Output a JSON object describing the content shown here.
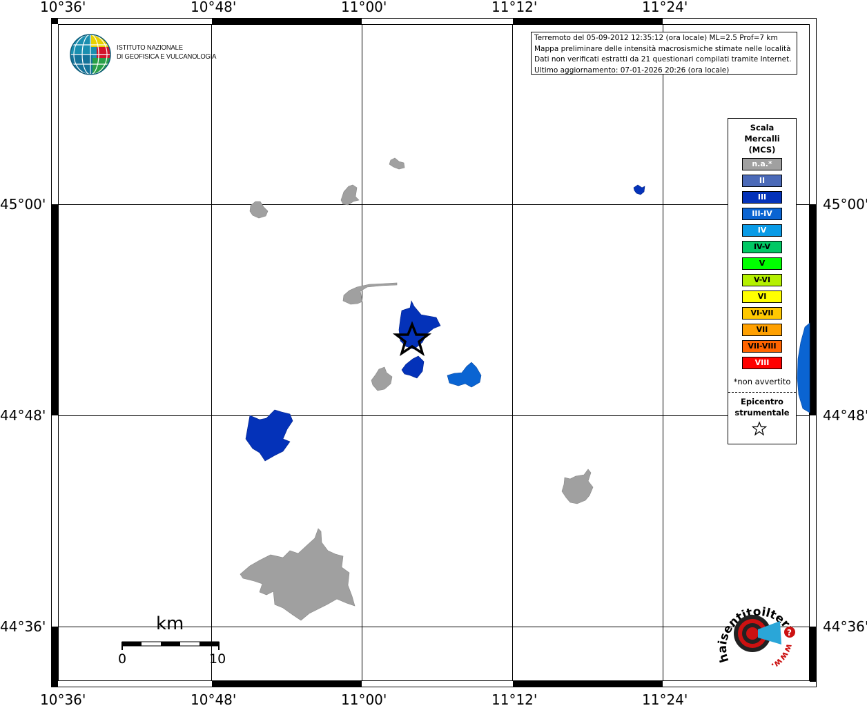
{
  "map": {
    "lon_ticks": [
      "10°36'",
      "10°48'",
      "11°00'",
      "11°12'",
      "11°24'"
    ],
    "lat_ticks": [
      "45°00'",
      "44°48'",
      "44°36'"
    ]
  },
  "institute": {
    "line1": "ISTITUTO NAZIONALE",
    "line2": "DI GEOFISICA E VULCANOLOGIA"
  },
  "info": {
    "line1": "Terremoto del 05-09-2012 12:35:12 (ora locale) ML=2.5 Prof=7 km",
    "line2": "Mappa preliminare delle intensità macrosismiche stimate nelle località",
    "line3": "Dati non verificati estratti da 21 questionari compilati tramite Internet.",
    "line4": "Ultimo aggiornamento: 07-01-2026 20:26 (ora locale)"
  },
  "legend": {
    "title1": "Scala",
    "title2": "Mercalli",
    "title3": "(MCS)",
    "classes": [
      {
        "label": "n.a.*",
        "color": "#a0a0a0",
        "text": "#ffffff"
      },
      {
        "label": "II",
        "color": "#4b6ab8",
        "text": "#ffffff"
      },
      {
        "label": "III",
        "color": "#0432b9",
        "text": "#ffffff"
      },
      {
        "label": "III-IV",
        "color": "#0a64d2",
        "text": "#ffffff"
      },
      {
        "label": "IV",
        "color": "#0a9be6",
        "text": "#ffffff"
      },
      {
        "label": "IV-V",
        "color": "#00c864",
        "text": "#000000"
      },
      {
        "label": "V",
        "color": "#00ff00",
        "text": "#000000"
      },
      {
        "label": "V-VI",
        "color": "#b4f000",
        "text": "#000000"
      },
      {
        "label": "VI",
        "color": "#ffff00",
        "text": "#000000"
      },
      {
        "label": "VI-VII",
        "color": "#ffc800",
        "text": "#000000"
      },
      {
        "label": "VII",
        "color": "#ffa000",
        "text": "#000000"
      },
      {
        "label": "VII-VIII",
        "color": "#ff6400",
        "text": "#000000"
      },
      {
        "label": "VIII",
        "color": "#ff0000",
        "text": "#ffffff"
      }
    ],
    "note": "*non avvertito",
    "epi1": "Epicentro",
    "epi2": "strumentale"
  },
  "scale": {
    "unit": "km",
    "zero": "0",
    "ten": "10"
  },
  "brand": {
    "text": "haisentitoilterremoto.it",
    "www": "www."
  }
}
